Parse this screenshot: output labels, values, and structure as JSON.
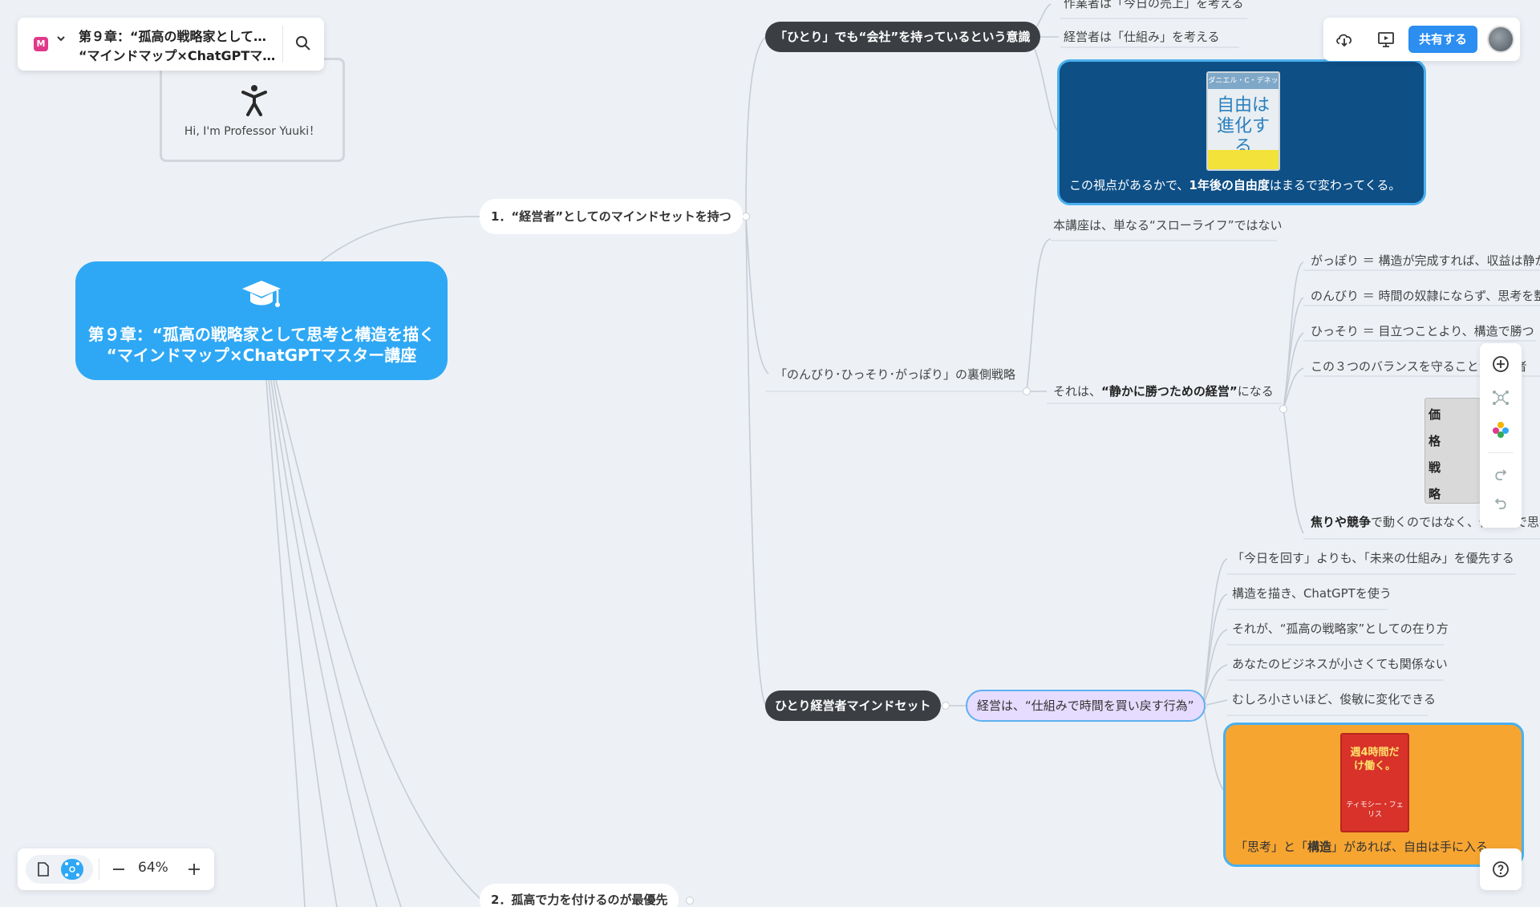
{
  "app": {
    "doc_title_line1": "第９章：“孤高の戦略家として…",
    "doc_title_line2": "“マインドマップ×ChatGPTマ…",
    "logo_letter": "M",
    "share_label": "共有する",
    "zoom_level": "64%"
  },
  "profile_card": {
    "text": "Hi, I'm  Professor Yuuki！"
  },
  "root": {
    "line1": "第９章：“孤高の戦略家として思考と構造を描く",
    "line2": "“マインドマップ×ChatGPTマスター講座"
  },
  "branches": {
    "b1": "1．“経営者”としてのマインドセットを持つ",
    "b2": "2．孤高で力を付けるのが最優先",
    "hitori_kaisha": "「ひとり」でも“会社”を持っているという意識",
    "sagyousha": "作業者は「今日の売上」を考える",
    "keieisha": "経営者は「仕組み」を考える",
    "card_blue_text_a": "この視点があるかで、",
    "card_blue_text_b": "1年後の自由度",
    "card_blue_text_c": "はまるで変わってくる。",
    "book_blue_author": "ダニエル・C・デネット",
    "book_blue_title": "自由は進化する",
    "nonbiri_strategy": "「のんびり･ひっそり･がっぽり」の裏側戦略",
    "slow_life": "本講座は、単なる“スローライフ”ではない",
    "shizuka_a": "それは、",
    "shizuka_b": "“静かに勝つための経営”",
    "shizuka_c": "になる",
    "gappori": "がっぽり ＝ 構造が完成すれば、収益は静か",
    "nonbiri": "のんびり ＝ 時間の奴隷にならず、思考を整",
    "hissori": "ひっそり ＝ 目立つことより、構造で勝つ",
    "balance": "この３つのバランスを守ることが経営者",
    "aseri_a": "焦りや競争",
    "aseri_b": "で動くのではなく、仕組みで思考",
    "book_price_title": "価格戦略",
    "mindset": "ひとり経営者マインドセット",
    "purple": "経営は、“仕組みで時間を買い戻す行為”",
    "mirai": "「今日を回す」よりも、「未来の仕組み」を優先する",
    "kouzou": "構造を描き、ChatGPTを使う",
    "arikata": "それが、“孤高の戦略家”としての在り方",
    "kankei": "あなたのビジネスが小さくても関係ない",
    "binkan": "むしろ小さいほど、俊敏に変化できる",
    "card_orange_text_a": "「思考」と「",
    "card_orange_text_b": "構造",
    "card_orange_text_c": "」があれば、自由は手に入る",
    "book_orange_title": "週4時間だけ働く。",
    "book_orange_author": "ティモシー・フェリス"
  },
  "colors": {
    "root": "#2ea8f5",
    "dark_pill": "#3b3f44",
    "card_blue": "#0e4f86",
    "card_orange": "#f7a531",
    "purple_pill": "#e6dcff",
    "share": "#2b8ef0",
    "background": "#edf1f6"
  },
  "icons": [
    "logo-icon",
    "chevron-down-icon",
    "search-icon",
    "person-icon",
    "graduation-cap-icon",
    "cloud-download-icon",
    "presentation-icon",
    "add-circle-icon",
    "mindmap-structure-icon",
    "color-palette-icon",
    "redo-icon",
    "undo-icon",
    "document-view-icon",
    "mindmap-view-icon",
    "zoom-out-icon",
    "zoom-in-icon",
    "help-icon"
  ]
}
